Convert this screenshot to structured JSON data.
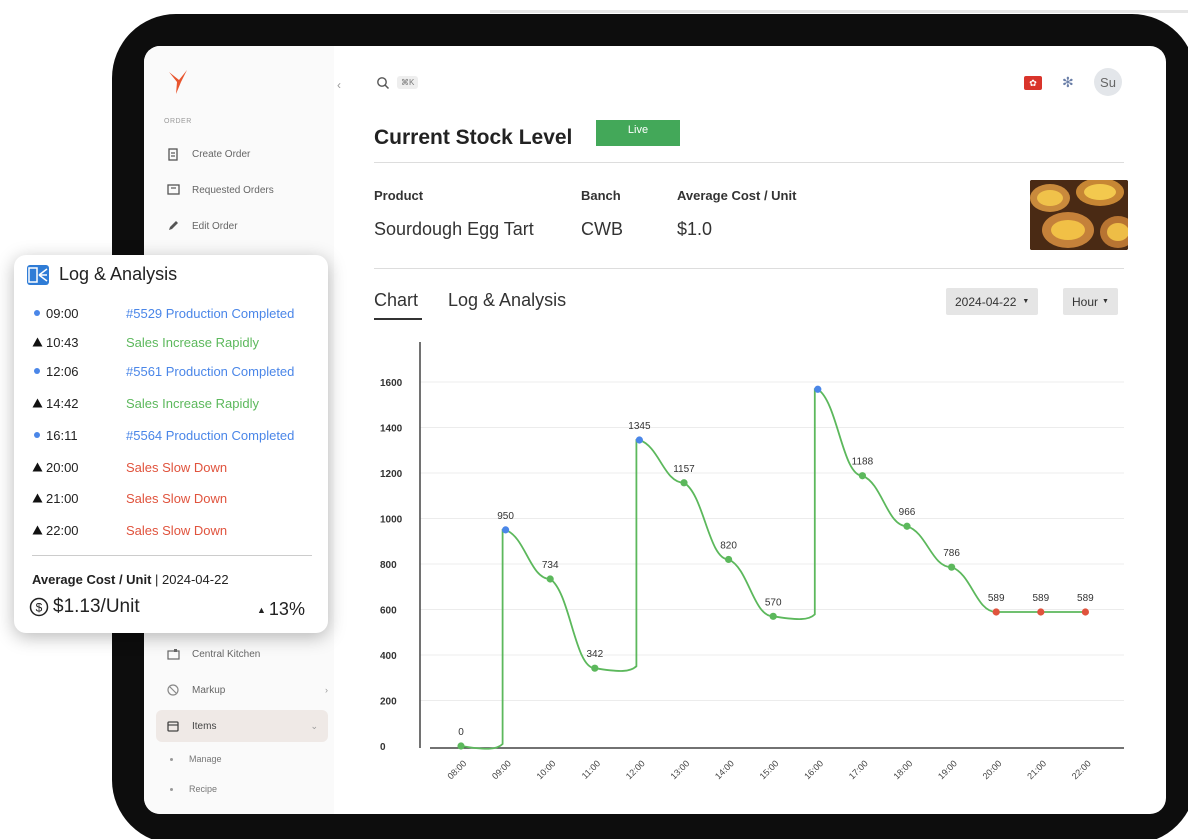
{
  "sidebar": {
    "section_label": "ORDER",
    "items": [
      {
        "label": "Create Order",
        "icon": "document-icon"
      },
      {
        "label": "Requested Orders",
        "icon": "inbox-icon"
      },
      {
        "label": "Edit Order",
        "icon": "pencil-icon"
      },
      {
        "label": "Central Kitchen",
        "icon": "kitchen-icon"
      },
      {
        "label": "Markup",
        "icon": "tag-icon"
      },
      {
        "label": "Items",
        "icon": "box-icon"
      }
    ],
    "sub_items": [
      "Manage",
      "Recipe"
    ],
    "collapse_glyph": "‹"
  },
  "header": {
    "shortcut": "⌘K",
    "avatar_initials": "Su",
    "flag_glyph": "✿"
  },
  "page": {
    "title": "Current Stock Level",
    "status_badge": "Live"
  },
  "product": {
    "headers": {
      "product": "Product",
      "branch": "Banch",
      "cost": "Average Cost / Unit"
    },
    "values": {
      "product": "Sourdough Egg Tart",
      "branch": "CWB",
      "cost": "$1.0"
    }
  },
  "tabs": [
    {
      "label": "Chart",
      "active": true
    },
    {
      "label": "Log & Analysis",
      "active": false
    }
  ],
  "filters": {
    "date": "2024-04-22",
    "interval": "Hour"
  },
  "chart_data": {
    "type": "line",
    "x": [
      "08:00",
      "09:00",
      "10:00",
      "11:00",
      "12:00",
      "13:00",
      "14:00",
      "15:00",
      "16:00",
      "17:00",
      "18:00",
      "19:00",
      "20:00",
      "21:00",
      "22:00"
    ],
    "values": [
      0,
      950,
      734,
      342,
      1345,
      1157,
      820,
      570,
      1568,
      1188,
      966,
      786,
      589,
      589,
      589
    ],
    "labels": [
      "0",
      "950",
      "734",
      "342",
      "1345",
      "1157",
      "820",
      "570",
      "",
      "1188",
      "966",
      "786",
      "589",
      "589",
      "589"
    ],
    "marker_types": [
      "normal",
      "production",
      "normal",
      "normal",
      "production",
      "normal",
      "normal",
      "normal",
      "production",
      "normal",
      "normal",
      "normal",
      "slow",
      "slow",
      "slow"
    ],
    "yticks": [
      0,
      200,
      400,
      600,
      800,
      1000,
      1200,
      1400,
      1600
    ],
    "ylim": [
      0,
      1750
    ],
    "colors": {
      "line": "#5cb85c",
      "production": "#4a86e8",
      "slow": "#e0533d",
      "normal": "#5cb85c"
    },
    "grid": true
  },
  "log_card": {
    "title": "Log & Analysis",
    "entries": [
      {
        "time": "09:00",
        "message": "#5529 Production Completed",
        "marker": "dot",
        "color": "#4a86e8"
      },
      {
        "time": "10:43",
        "message": "Sales Increase Rapidly",
        "marker": "triangle",
        "color": "#5cb85c"
      },
      {
        "time": "12:06",
        "message": "#5561 Production Completed",
        "marker": "dot",
        "color": "#4a86e8"
      },
      {
        "time": "14:42",
        "message": "Sales Increase Rapidly",
        "marker": "triangle",
        "color": "#5cb85c"
      },
      {
        "time": "16:11",
        "message": "#5564 Production Completed",
        "marker": "dot",
        "color": "#4a86e8"
      },
      {
        "time": "20:00",
        "message": "Sales Slow Down",
        "marker": "triangle",
        "color": "#e0533d"
      },
      {
        "time": "21:00",
        "message": "Sales Slow Down",
        "marker": "triangle",
        "color": "#e0533d"
      },
      {
        "time": "22:00",
        "message": "Sales Slow Down",
        "marker": "triangle",
        "color": "#e0533d"
      }
    ],
    "cost_label": "Average Cost / Unit",
    "cost_separator": " | ",
    "cost_date": "2024-04-22",
    "cost_value": "$1.13/Unit",
    "change": "13%"
  }
}
